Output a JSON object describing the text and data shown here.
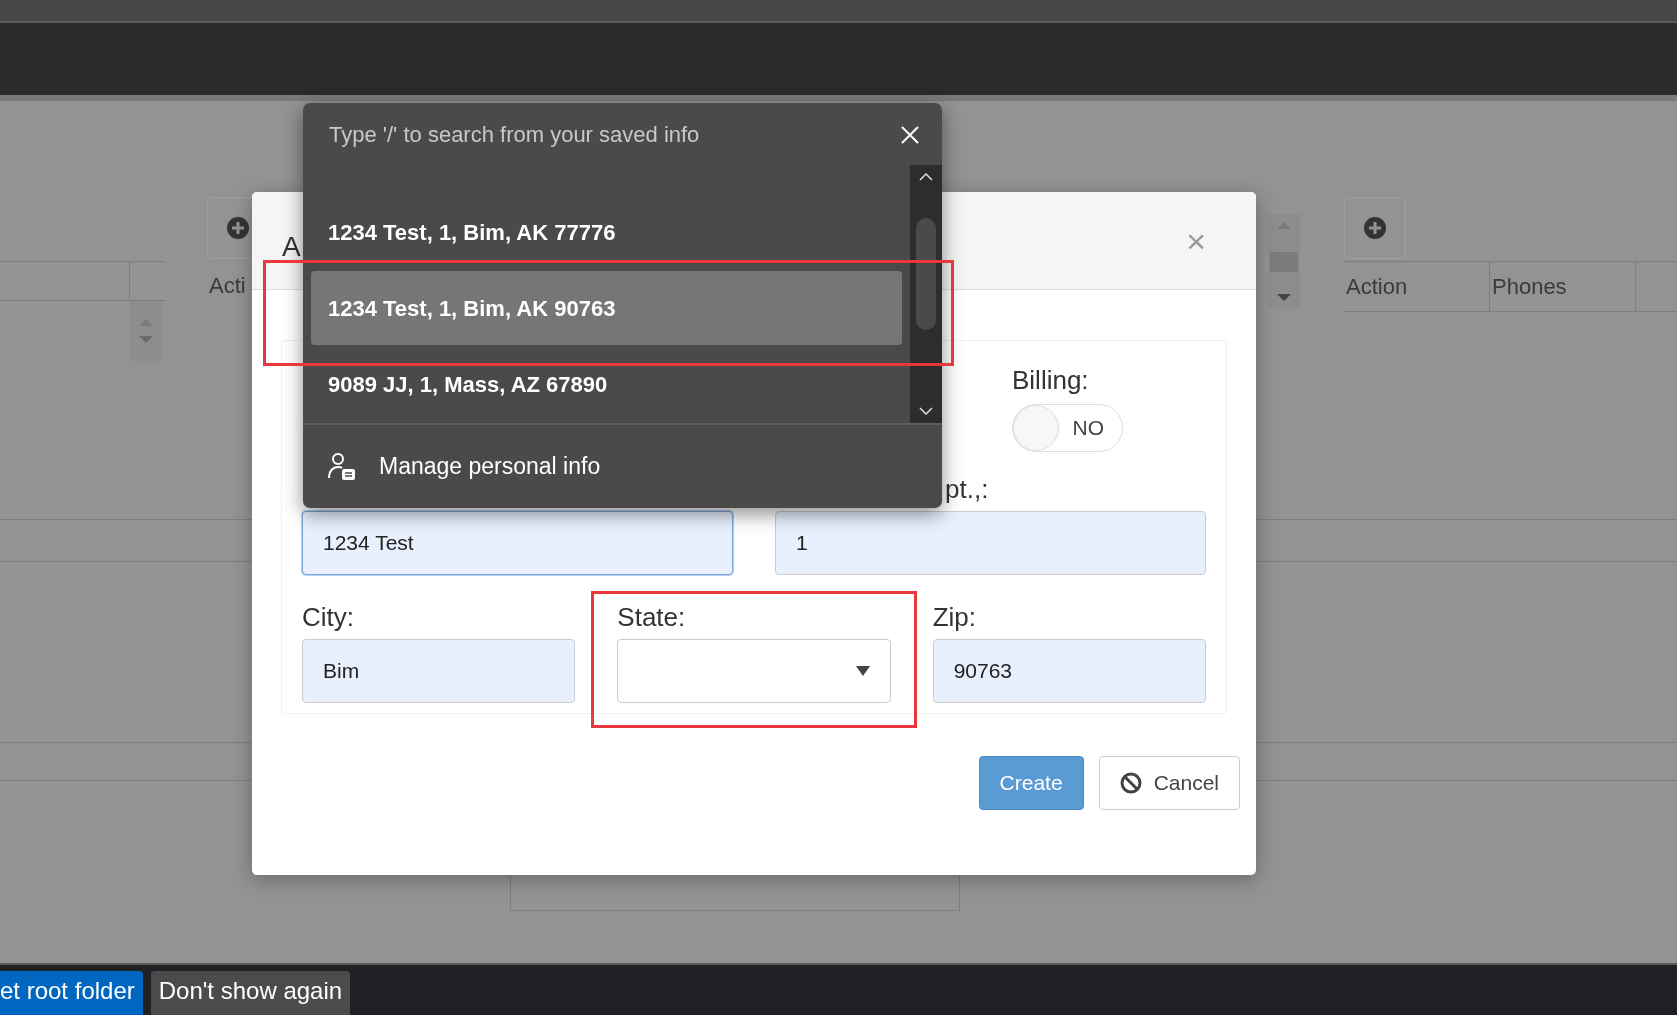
{
  "background": {
    "left_table": {
      "header": "Acti"
    },
    "right_table": {
      "columns": [
        "Action",
        "Phones"
      ]
    }
  },
  "dialog": {
    "title": "A",
    "close": "×",
    "billing": {
      "label": "Billing:",
      "on": false,
      "text": "NO"
    },
    "fields": [
      {
        "kind": "input",
        "value": "1234 Test",
        "focused": true,
        "highlighted": false
      },
      {
        "kind": "input",
        "label": "pt.,:",
        "value": "1",
        "focused": false,
        "highlighted": false
      },
      {
        "kind": "input",
        "label": "City:",
        "value": "Bim",
        "focused": false,
        "highlighted": false
      },
      {
        "kind": "select",
        "label": "State:",
        "focused": false,
        "highlighted": true
      },
      {
        "kind": "input",
        "label": "Zip:",
        "value": "90763",
        "focused": false,
        "highlighted": false
      }
    ],
    "buttons": [
      {
        "label": "Create",
        "kind": "primary"
      },
      {
        "label": "Cancel",
        "kind": "cancel"
      }
    ]
  },
  "autofill": {
    "placeholder": "Type '/' to search from your saved info",
    "items": [
      {
        "text": "1234 Test, 1, Bim, AK 77776",
        "selected": false,
        "highlighted": false
      },
      {
        "text": "1234 Test, 1, Bim, AK 90763",
        "selected": true,
        "highlighted": true
      },
      {
        "text": "9089 JJ, 1, Mass, AZ 67890",
        "selected": false,
        "highlighted": false
      }
    ],
    "footer": "Manage personal info"
  },
  "bottom_bar": {
    "buttons": [
      {
        "label": "et root folder",
        "kind": "primary"
      },
      {
        "label": "Don't show again",
        "kind": "secondary"
      }
    ]
  }
}
